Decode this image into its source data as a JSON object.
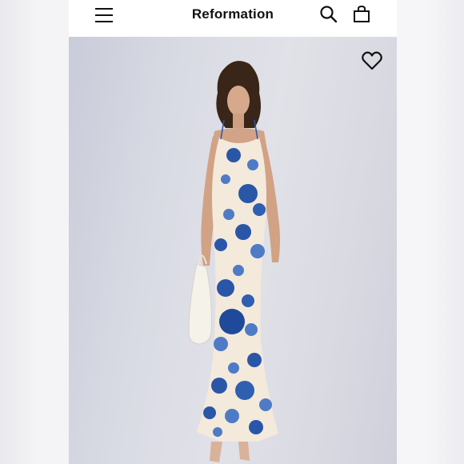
{
  "header": {
    "brand": "Reformation",
    "menu_icon": "hamburger-menu-icon",
    "search_icon": "search-icon",
    "bag_icon": "shopping-bag-icon"
  },
  "product_image": {
    "favorite_icon": "heart-outline-icon",
    "dress_colors": [
      "#f3eadc",
      "#2a56a8",
      "#4f7bc6"
    ]
  }
}
